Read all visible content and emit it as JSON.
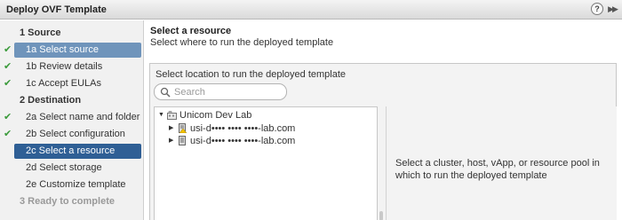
{
  "window": {
    "title": "Deploy OVF Template"
  },
  "steps": [
    {
      "label": "1  Source"
    },
    {
      "label": "1a  Select source"
    },
    {
      "label": "1b  Review details"
    },
    {
      "label": "1c  Accept EULAs"
    },
    {
      "label": "2  Destination"
    },
    {
      "label": "2a  Select name and folder"
    },
    {
      "label": "2b  Select configuration"
    },
    {
      "label": "2c  Select a resource"
    },
    {
      "label": "2d  Select storage"
    },
    {
      "label": "2e  Customize template"
    },
    {
      "label": "3  Ready to complete"
    }
  ],
  "content": {
    "title": "Select a resource",
    "subtitle": "Select where to run the deployed template",
    "panel_label": "Select location to run the deployed template",
    "search": {
      "placeholder": "Search",
      "value": ""
    },
    "tree": {
      "root": "Unicom Dev Lab",
      "hosts": [
        "usi-d•••• •••• ••••-lab.com",
        "usi-d•••• •••• ••••-lab.com"
      ]
    },
    "info": "Select a cluster, host, vApp, or resource pool in which to run the deployed template"
  },
  "colors": {
    "accent_light": "#6f94bb",
    "accent_dark": "#2f5f95",
    "check": "#3a9a3a"
  }
}
